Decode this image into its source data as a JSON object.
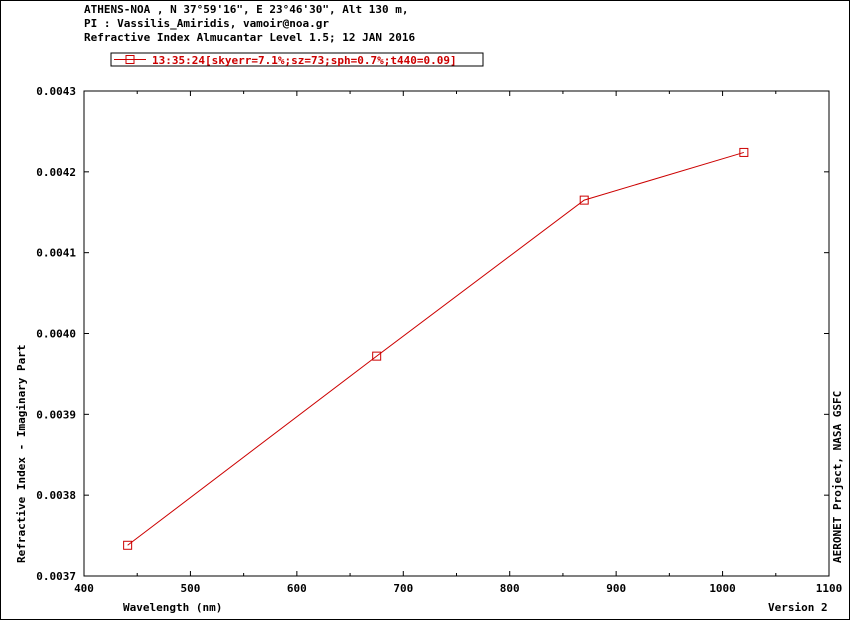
{
  "header": {
    "line1": "ATHENS-NOA , N 37°59'16\", E 23°46'30\", Alt 130 m,",
    "line2": "PI : Vassilis_Amiridis, vamoir@noa.gr",
    "line3": "Refractive Index Almucantar Level 1.5; 12 JAN 2016"
  },
  "footer": {
    "credit": "AERONET Project, NASA GSFC",
    "version": "Version 2"
  },
  "colors": {
    "series": "#cc0000",
    "axis": "#000000"
  },
  "chart_data": {
    "type": "line",
    "xlabel": "Wavelength (nm)",
    "ylabel": "Refractive Index - Imaginary Part",
    "xlim": [
      400,
      1100
    ],
    "ylim": [
      0.0037,
      0.0043
    ],
    "x_ticks": [
      400,
      500,
      600,
      700,
      800,
      900,
      1000,
      1100
    ],
    "y_ticks": [
      0.0037,
      0.0038,
      0.0039,
      0.004,
      0.0041,
      0.0042,
      0.0043
    ],
    "y_tick_labels": [
      "0.0037",
      "0.0038",
      "0.0039",
      "0.0040",
      "0.0041",
      "0.0042",
      "0.0043"
    ],
    "grid": false,
    "legend_position": "top-left",
    "marker": "square",
    "series": [
      {
        "name": "13:35:24[skyerr=7.1%;sz=73;sph=0.7%;t440=0.09]",
        "x": [
          441,
          675,
          870,
          1020
        ],
        "y": [
          0.003738,
          0.003972,
          0.004165,
          0.004224
        ]
      }
    ]
  }
}
